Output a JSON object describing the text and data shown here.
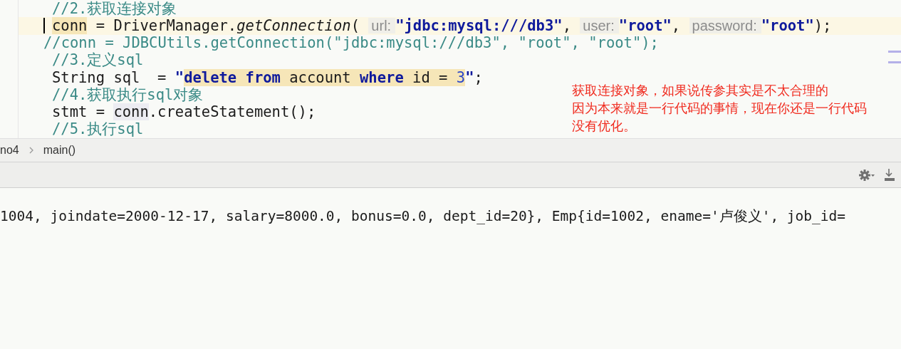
{
  "editor": {
    "lines": [
      {
        "kind": "code",
        "current": false,
        "tokens": [
          {
            "kind": "comment",
            "text": "//2.获取连接对象",
            "highlighted": false
          }
        ]
      },
      {
        "kind": "code",
        "current": true,
        "tokens": [
          {
            "kind": "plain",
            "text": "conn",
            "highlighted": true
          },
          {
            "kind": "plain",
            "text": " = DriverManager.",
            "highlighted": false
          },
          {
            "kind": "method",
            "text": "getConnection",
            "highlighted": false
          },
          {
            "kind": "plain",
            "text": "( ",
            "highlighted": false
          },
          {
            "kind": "hint",
            "text": "url:",
            "highlighted": false
          },
          {
            "kind": "string",
            "text": "\"jdbc:mysql:///db3\"",
            "highlighted": false
          },
          {
            "kind": "plain",
            "text": ", ",
            "highlighted": false
          },
          {
            "kind": "hint",
            "text": "user:",
            "highlighted": false
          },
          {
            "kind": "string",
            "text": "\"root\"",
            "highlighted": false
          },
          {
            "kind": "plain",
            "text": ", ",
            "highlighted": false
          },
          {
            "kind": "hint",
            "text": "password:",
            "highlighted": false
          },
          {
            "kind": "string",
            "text": "\"root\"",
            "highlighted": false
          },
          {
            "kind": "plain",
            "text": ");",
            "highlighted": false
          }
        ]
      },
      {
        "kind": "line-comment",
        "current": false,
        "tokens": [
          {
            "kind": "comment",
            "text": "//conn = JDBCUtils.getConnection(\"jdbc:mysql:///db3\", \"root\", \"root\");",
            "highlighted": false
          }
        ]
      },
      {
        "kind": "code",
        "current": false,
        "tokens": [
          {
            "kind": "comment",
            "text": "//3.定义sql",
            "highlighted": false
          }
        ]
      },
      {
        "kind": "code",
        "current": false,
        "tokens": [
          {
            "kind": "plain",
            "text": "String sql  = ",
            "highlighted": false
          },
          {
            "kind": "string",
            "text": "\"",
            "highlighted": false
          },
          {
            "kind": "string",
            "text": "delete",
            "highlighted": true
          },
          {
            "kind": "string",
            "text": " from",
            "highlighted": true
          },
          {
            "kind": "plain",
            "text": " account ",
            "highlighted": true
          },
          {
            "kind": "string",
            "text": "where",
            "highlighted": true
          },
          {
            "kind": "plain",
            "text": " id = ",
            "highlighted": true
          },
          {
            "kind": "number",
            "text": "3",
            "highlighted": true
          },
          {
            "kind": "string",
            "text": "\"",
            "highlighted": false
          },
          {
            "kind": "plain",
            "text": ";",
            "highlighted": false
          }
        ]
      },
      {
        "kind": "code",
        "current": false,
        "tokens": [
          {
            "kind": "comment",
            "text": "//4.获取执行sql对象",
            "highlighted": false
          }
        ]
      },
      {
        "kind": "code",
        "current": false,
        "tokens": [
          {
            "kind": "plain",
            "text": "stmt = ",
            "highlighted": false
          },
          {
            "kind": "usage",
            "text": "conn",
            "highlighted": true
          },
          {
            "kind": "plain",
            "text": ".createStatement();",
            "highlighted": false
          }
        ]
      },
      {
        "kind": "code",
        "current": false,
        "tokens": [
          {
            "kind": "comment",
            "text": "//5.执行sql",
            "highlighted": false
          }
        ]
      }
    ]
  },
  "annotation": [
    "获取连接对象，如果说传参其实是不太合理的",
    "因为本来就是一行代码的事情，现在你还是一行代码",
    "没有优化。"
  ],
  "breadcrumb": [
    "no4",
    "main()"
  ],
  "console": {
    "output": "1004, joindate=2000-12-17, salary=8000.0, bonus=0.0, dept_id=20}, Emp{id=1002, ename='卢俊义', job_id="
  }
}
